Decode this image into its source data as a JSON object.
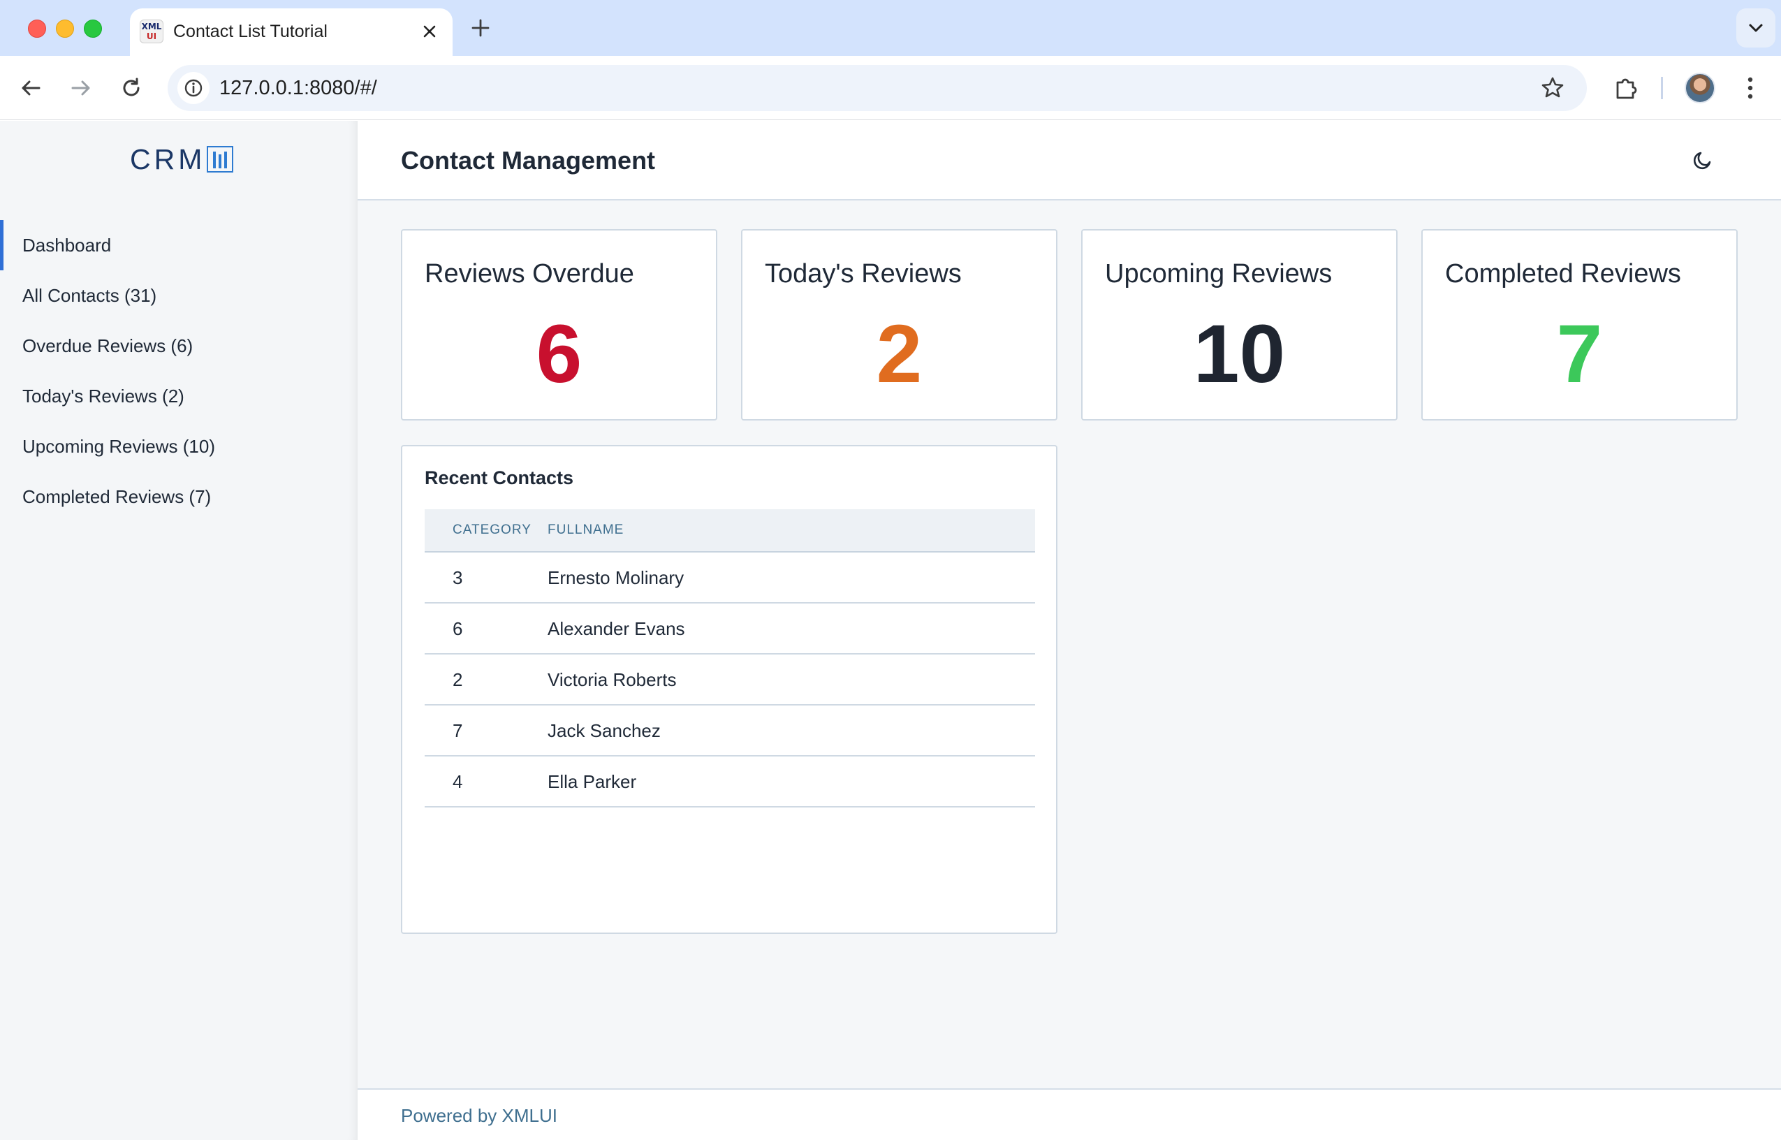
{
  "browser": {
    "tab_title": "Contact List Tutorial",
    "favicon_text_top": "XML",
    "favicon_text_bottom": "UI",
    "url": "127.0.0.1:8080/#/"
  },
  "sidebar": {
    "logo_text": "CRM",
    "items": [
      {
        "label": "Dashboard",
        "active": true
      },
      {
        "label": "All Contacts (31)",
        "active": false
      },
      {
        "label": "Overdue Reviews (6)",
        "active": false
      },
      {
        "label": "Today's Reviews (2)",
        "active": false
      },
      {
        "label": "Upcoming Reviews (10)",
        "active": false
      },
      {
        "label": "Completed Reviews (7)",
        "active": false
      }
    ]
  },
  "header": {
    "title": "Contact Management"
  },
  "cards": [
    {
      "label": "Reviews Overdue",
      "value": "6",
      "color": "#c8102e"
    },
    {
      "label": "Today's Reviews",
      "value": "2",
      "color": "#e06c1f"
    },
    {
      "label": "Upcoming Reviews",
      "value": "10",
      "color": "#1f2530"
    },
    {
      "label": "Completed Reviews",
      "value": "7",
      "color": "#3cc85a"
    }
  ],
  "recent_contacts": {
    "title": "Recent Contacts",
    "columns": [
      "CATEGORY",
      "FULLNAME"
    ],
    "rows": [
      {
        "category": "3",
        "fullname": "Ernesto Molinary"
      },
      {
        "category": "6",
        "fullname": "Alexander Evans"
      },
      {
        "category": "2",
        "fullname": "Victoria Roberts"
      },
      {
        "category": "7",
        "fullname": "Jack Sanchez"
      },
      {
        "category": "4",
        "fullname": "Ella Parker"
      }
    ]
  },
  "footer": {
    "text": "Powered by XMLUI"
  },
  "colors": {
    "accent": "#2f6fd6",
    "sidebar_bg": "#f4f6f8",
    "main_bg": "#f5f7f9",
    "tab_strip": "#d3e3fd"
  }
}
